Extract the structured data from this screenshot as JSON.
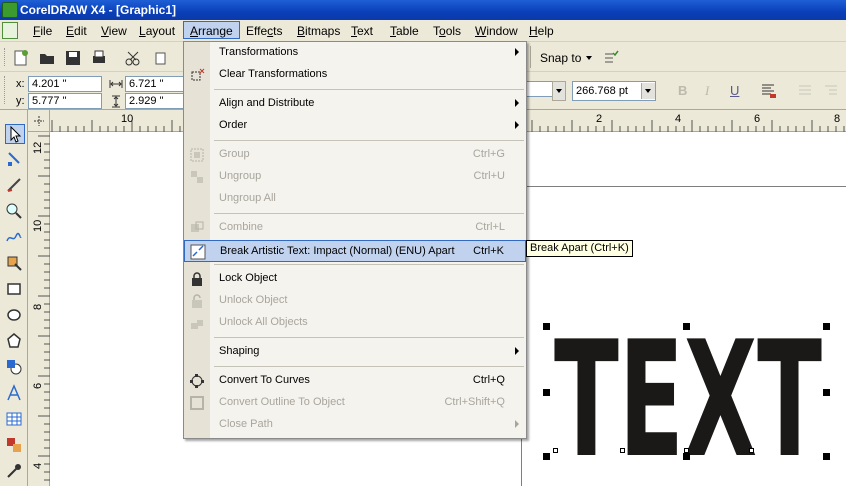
{
  "window": {
    "title": "CorelDRAW X4 - [Graphic1]"
  },
  "menubar": {
    "items": [
      {
        "label": "File",
        "u": "F"
      },
      {
        "label": "Edit",
        "u": "E"
      },
      {
        "label": "View",
        "u": "V"
      },
      {
        "label": "Layout",
        "u": "L"
      },
      {
        "label": "Arrange",
        "u": "A"
      },
      {
        "label": "Effects",
        "u": "c"
      },
      {
        "label": "Bitmaps",
        "u": "B"
      },
      {
        "label": "Text",
        "u": "T"
      },
      {
        "label": "Table",
        "u": "T"
      },
      {
        "label": "Tools",
        "u": "o"
      },
      {
        "label": "Window",
        "u": "W"
      },
      {
        "label": "Help",
        "u": "H"
      }
    ]
  },
  "toolbar": {
    "snap_to": "Snap to"
  },
  "propertybar": {
    "x_label": "x:",
    "x_value": "4.201 \"",
    "y_label": "y:",
    "y_value": "5.777 \"",
    "w_value": "6.721 \"",
    "h_value": "2.929 \"",
    "font_size": "266.768 pt"
  },
  "ruler": {
    "h_ticks": [
      "10",
      "2",
      "4",
      "6",
      "8"
    ],
    "v_ticks": [
      "12",
      "10",
      "8",
      "6",
      "4"
    ]
  },
  "arrange_menu": [
    {
      "label": "Transformations",
      "shortcut": "",
      "submenu": true,
      "disabled": false
    },
    {
      "label": "Clear Transformations",
      "shortcut": "",
      "submenu": false,
      "disabled": false
    },
    {
      "label": "Align and Distribute",
      "shortcut": "",
      "submenu": true,
      "disabled": false
    },
    {
      "label": "Order",
      "shortcut": "",
      "submenu": true,
      "disabled": false
    },
    {
      "label": "Group",
      "shortcut": "Ctrl+G",
      "submenu": false,
      "disabled": true
    },
    {
      "label": "Ungroup",
      "shortcut": "Ctrl+U",
      "submenu": false,
      "disabled": true
    },
    {
      "label": "Ungroup All",
      "shortcut": "",
      "submenu": false,
      "disabled": true
    },
    {
      "label": "Combine",
      "shortcut": "Ctrl+L",
      "submenu": false,
      "disabled": true
    },
    {
      "label": "Break Artistic Text: Impact (Normal) (ENU) Apart",
      "shortcut": "Ctrl+K",
      "submenu": false,
      "disabled": false
    },
    {
      "label": "Lock Object",
      "shortcut": "",
      "submenu": false,
      "disabled": false
    },
    {
      "label": "Unlock Object",
      "shortcut": "",
      "submenu": false,
      "disabled": true
    },
    {
      "label": "Unlock All Objects",
      "shortcut": "",
      "submenu": false,
      "disabled": true
    },
    {
      "label": "Shaping",
      "shortcut": "",
      "submenu": true,
      "disabled": false
    },
    {
      "label": "Convert To Curves",
      "shortcut": "Ctrl+Q",
      "submenu": false,
      "disabled": false
    },
    {
      "label": "Convert Outline To Object",
      "shortcut": "Ctrl+Shift+Q",
      "submenu": false,
      "disabled": true
    },
    {
      "label": "Close Path",
      "shortcut": "",
      "submenu": true,
      "disabled": true
    }
  ],
  "tooltip": "Break Apart (Ctrl+K)",
  "canvas_text": "TEXT",
  "colors": {
    "accent": "#316ac5",
    "highlight": "#c1d2ee",
    "title": "#0a3fb8"
  }
}
